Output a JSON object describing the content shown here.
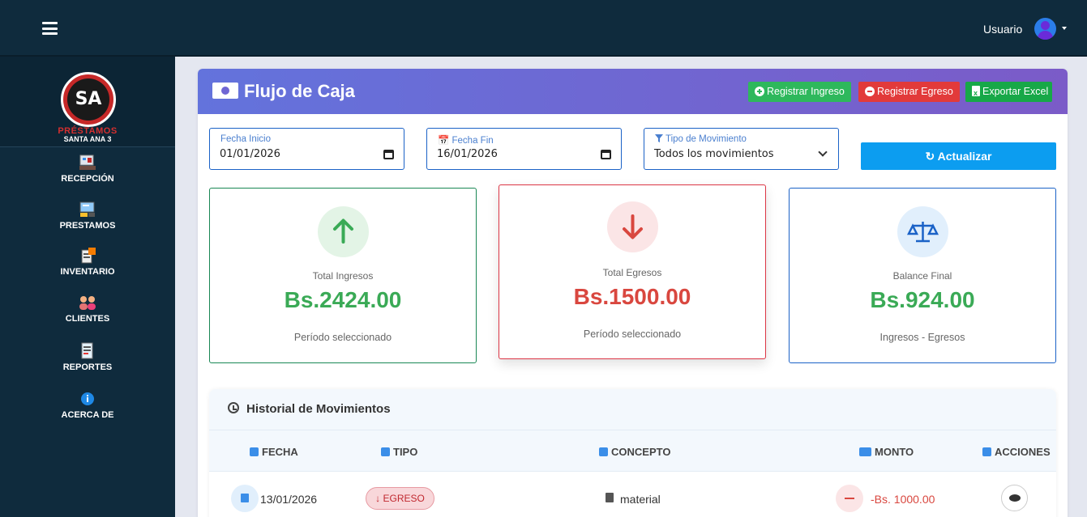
{
  "topbar": {
    "user_label": "Usuario"
  },
  "brand": {
    "logo_text": "SA",
    "line1": "PRÉSTAMOS",
    "line2": "SANTA ANA 3"
  },
  "sidebar": {
    "items": [
      {
        "label": "RECEPCIÓN",
        "icon": "reception-icon"
      },
      {
        "label": "PRESTAMOS",
        "icon": "loans-icon"
      },
      {
        "label": "INVENTARIO",
        "icon": "inventory-icon"
      },
      {
        "label": "CLIENTES",
        "icon": "clients-icon"
      },
      {
        "label": "REPORTES",
        "icon": "reports-icon"
      },
      {
        "label": "ACERCA DE",
        "icon": "info-icon"
      }
    ]
  },
  "page": {
    "title": "Flujo de Caja",
    "actions": {
      "register_income": "Registrar Ingreso",
      "register_expense": "Registrar Egreso",
      "export_excel": "Exportar Excel"
    }
  },
  "filters": {
    "start_date": {
      "label": "Fecha Inicio",
      "value": "01/01/2026"
    },
    "end_date": {
      "label": "Fecha Fin",
      "value": "16/01/2026"
    },
    "movement_type": {
      "label": "Tipo de Movimiento",
      "value": "Todos los movimientos"
    },
    "refresh_label": "Actualizar"
  },
  "stats": {
    "income": {
      "label": "Total Ingresos",
      "value": "Bs.2424.00",
      "sub": "Período seleccionado"
    },
    "expense": {
      "label": "Total Egresos",
      "value": "Bs.1500.00",
      "sub": "Período seleccionado"
    },
    "balance": {
      "label": "Balance Final",
      "value": "Bs.924.00",
      "sub": "Ingresos - Egresos"
    }
  },
  "history": {
    "title": "Historial de Movimientos",
    "columns": [
      "FECHA",
      "TIPO",
      "CONCEPTO",
      "MONTO",
      "ACCIONES"
    ],
    "rows": [
      {
        "date": "13/01/2026",
        "type": "EGRESO",
        "concept": "material",
        "amount": "-Bs. 1000.00"
      }
    ]
  },
  "colors": {
    "sidebar_bg": "#0f2b3d",
    "header_gradient_start": "#6373dc",
    "header_gradient_end": "#7b5bc8",
    "income_green": "#3aaa56",
    "expense_red": "#d9473f",
    "refresh_blue": "#0c9df0"
  }
}
